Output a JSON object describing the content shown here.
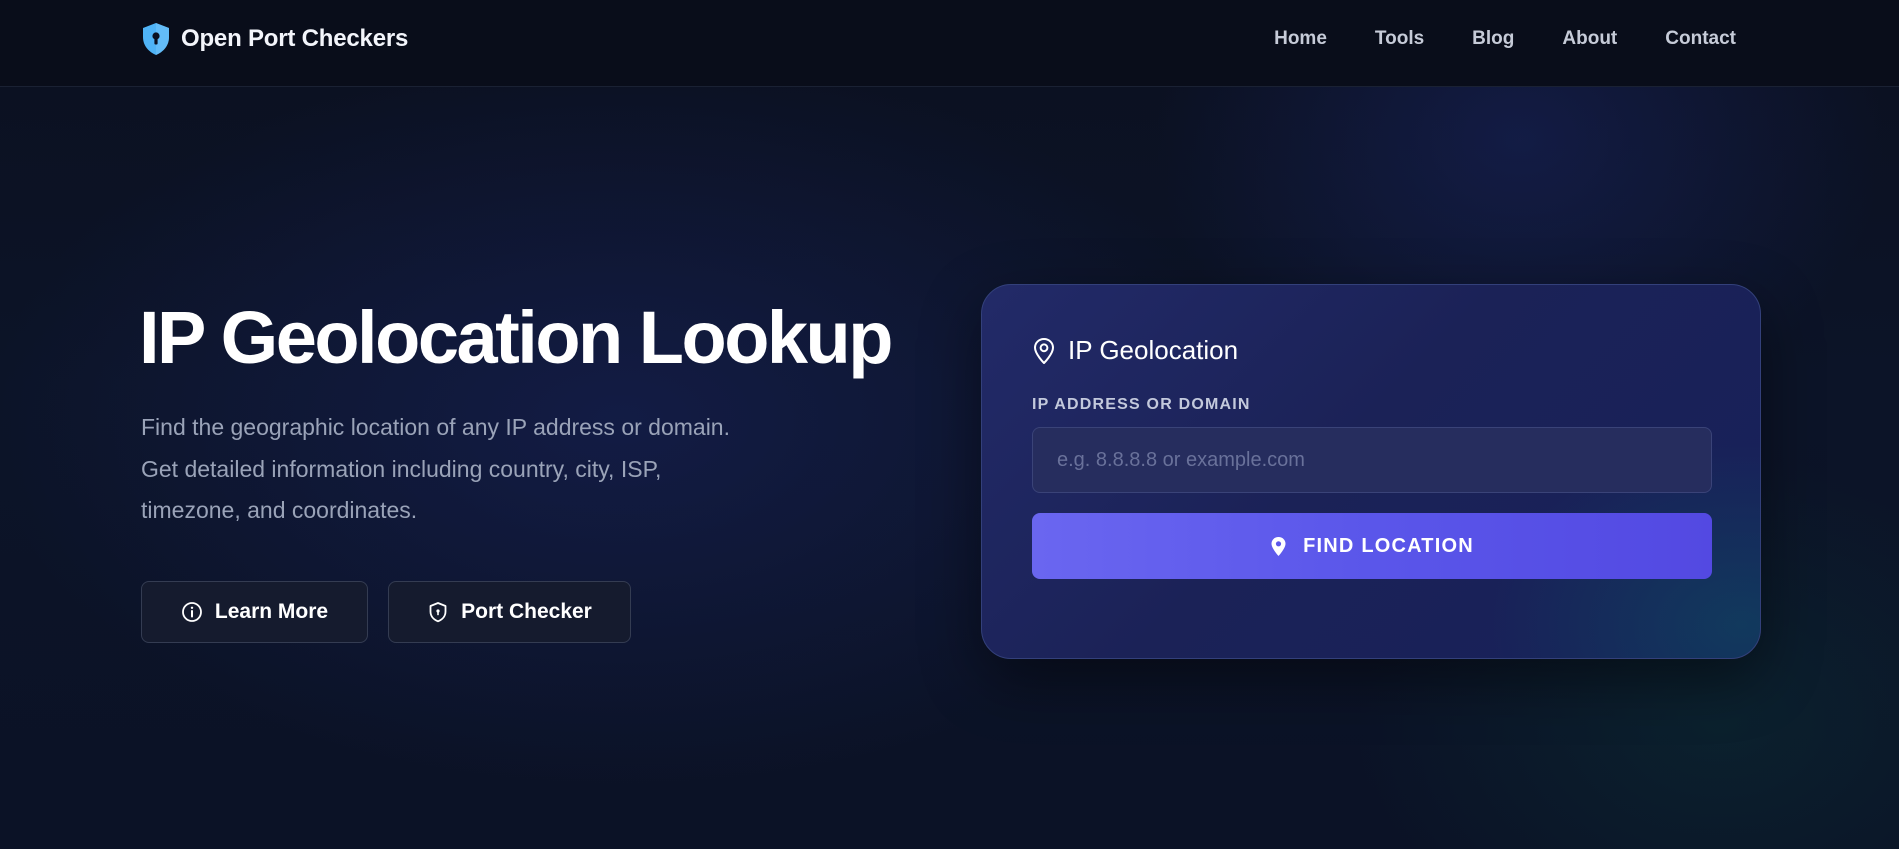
{
  "brand": {
    "name": "Open Port Checkers",
    "icon": "shield-keyhole-icon",
    "accent_color": "#4fb3f6"
  },
  "nav": {
    "items": [
      {
        "label": "Home"
      },
      {
        "label": "Tools"
      },
      {
        "label": "Blog"
      },
      {
        "label": "About"
      },
      {
        "label": "Contact"
      }
    ]
  },
  "hero": {
    "title": "IP Geolocation Lookup",
    "description_lines": [
      "Find the geographic location of any IP address or domain.",
      "Get detailed information including country, city, ISP,",
      "timezone, and coordinates."
    ],
    "buttons": {
      "learn_more": {
        "label": "Learn More",
        "icon": "info-circle-icon"
      },
      "port_checker": {
        "label": "Port Checker",
        "icon": "shield-icon"
      }
    }
  },
  "card": {
    "title": "IP Geolocation",
    "title_icon": "map-pin-outline-icon",
    "field_label": "IP ADDRESS OR DOMAIN",
    "input": {
      "value": "",
      "placeholder": "e.g. 8.8.8.8 or example.com"
    },
    "submit": {
      "label": "FIND LOCATION",
      "icon": "map-pin-icon",
      "color": "#5b57ea"
    }
  }
}
